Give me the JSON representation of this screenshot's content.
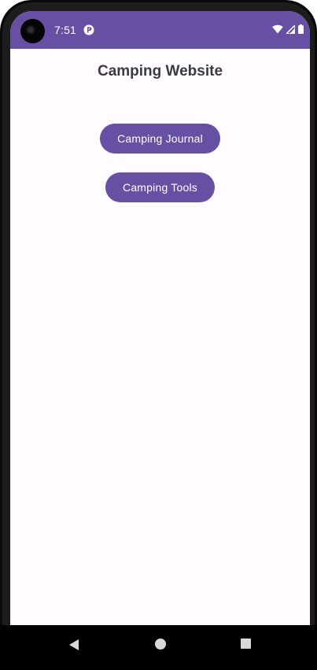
{
  "status_bar": {
    "time": "7:51",
    "notification_icon": "app-notification-icon",
    "icons": [
      "wifi-icon",
      "signal-icon",
      "battery-icon"
    ],
    "background_color": "#6750a4"
  },
  "app": {
    "title": "Camping Website",
    "buttons": {
      "journal_label": "Camping Journal",
      "tools_label": "Camping Tools"
    },
    "accent_color": "#6750a4",
    "background_color": "#fffbfe"
  },
  "nav_bar": {
    "icons": [
      "back-icon",
      "home-icon",
      "recents-icon"
    ]
  }
}
